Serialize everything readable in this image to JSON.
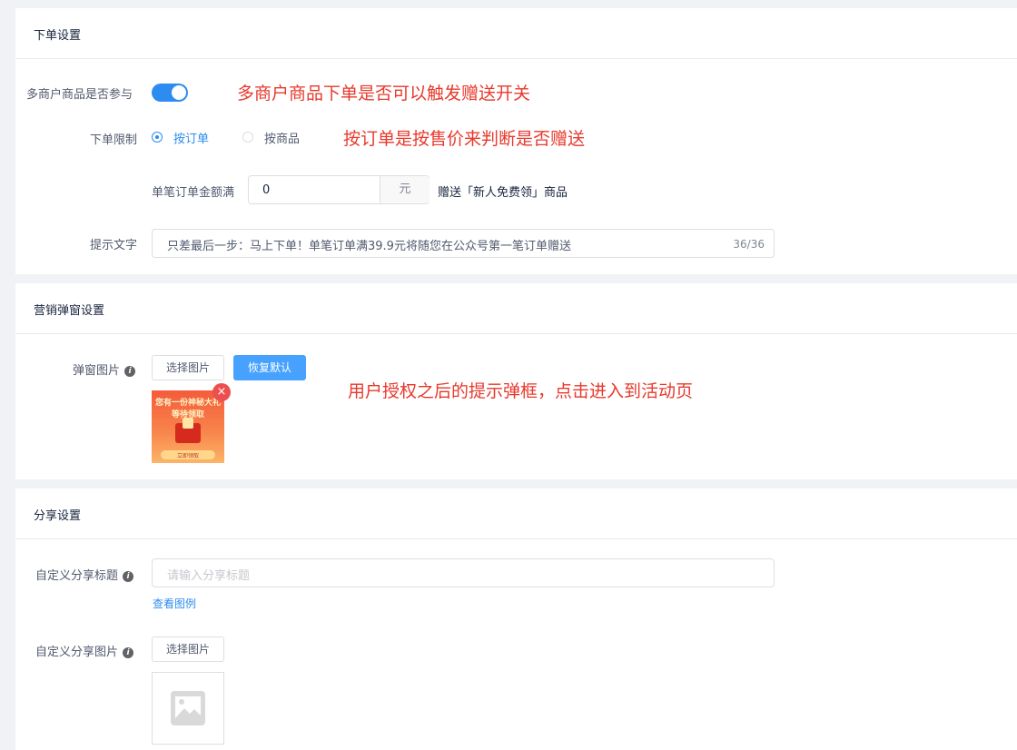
{
  "order_section": {
    "title": "下单设置",
    "multi_merchant_label": "多商户商品是否参与",
    "multi_merchant_enabled": true,
    "multi_merchant_annotation": "多商户商品下单是否可以触发赠送开关",
    "limit_label": "下单限制",
    "limit_options": [
      "按订单",
      "按商品"
    ],
    "limit_selected": "按订单",
    "limit_annotation": "按订单是按售价来判断是否赠送",
    "amount_label": "单笔订单金额满",
    "amount_value": "0",
    "amount_unit": "元",
    "amount_suffix": "赠送「新人免费领」商品",
    "hint_label": "提示文字",
    "hint_value": "只差最后一步：马上下单！单笔订单满39.9元将随您在公众号第一笔订单赠送",
    "hint_count": "36/36"
  },
  "popup_section": {
    "title": "营销弹窗设置",
    "image_label": "弹窗图片",
    "choose_button": "选择图片",
    "restore_button": "恢复默认",
    "annotation": "用户授权之后的提示弹框，点击进入到活动页",
    "thumb_text_top": "您有一份神秘大礼",
    "thumb_text_mid": "等待领取",
    "thumb_button": "立即领取"
  },
  "share_section": {
    "title": "分享设置",
    "share_title_label": "自定义分享标题",
    "share_title_placeholder": "请输入分享标题",
    "view_example_link": "查看图例",
    "share_image_label": "自定义分享图片",
    "choose_button": "选择图片"
  },
  "colors": {
    "accent": "#2d8cf0",
    "annotation": "#e8382c",
    "primary_button": "#47a2ff"
  }
}
